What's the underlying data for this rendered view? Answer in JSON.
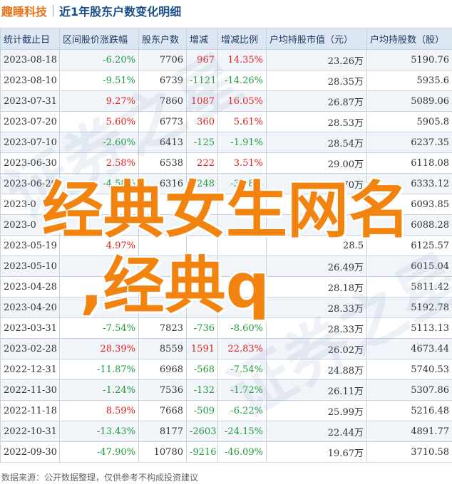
{
  "header": {
    "company": "趣睡科技",
    "title": "近1年股东户数变化明细"
  },
  "table": {
    "columns": [
      "统计截止日",
      "区间股价涨跌幅",
      "股东户数",
      "增减",
      "增减比例",
      "户均持股市值（元）",
      "户均持股数（股）"
    ],
    "rows": [
      {
        "date": "2023-08-18",
        "pct": "-6.20%",
        "holders": "7706",
        "change": "967",
        "ratio": "14.35%",
        "value": "23.26万",
        "shares": "5190.76",
        "pct_dir": "down",
        "change_dir": "up",
        "ratio_dir": "up"
      },
      {
        "date": "2023-08-10",
        "pct": "-9.51%",
        "holders": "6739",
        "change": "-1121",
        "ratio": "-14.26%",
        "value": "28.35万",
        "shares": "5935.6",
        "pct_dir": "down",
        "change_dir": "down",
        "ratio_dir": "down"
      },
      {
        "date": "2023-07-31",
        "pct": "9.27%",
        "holders": "7860",
        "change": "1087",
        "ratio": "16.05%",
        "value": "26.87万",
        "shares": "5089.06",
        "pct_dir": "up",
        "change_dir": "up",
        "ratio_dir": "up"
      },
      {
        "date": "2023-07-20",
        "pct": "5.60%",
        "holders": "6773",
        "change": "360",
        "ratio": "5.61%",
        "value": "28.53万",
        "shares": "5905.8",
        "pct_dir": "up",
        "change_dir": "up",
        "ratio_dir": "up"
      },
      {
        "date": "2023-07-10",
        "pct": "-2.60%",
        "holders": "6413",
        "change": "-125",
        "ratio": "-1.91%",
        "value": "28.54万",
        "shares": "6237.35",
        "pct_dir": "down",
        "change_dir": "down",
        "ratio_dir": "down"
      },
      {
        "date": "2023-06-30",
        "pct": "2.58%",
        "holders": "6538",
        "change": "222",
        "ratio": "3.51%",
        "value": "29.00万",
        "shares": "6118.08",
        "pct_dir": "up",
        "change_dir": "up",
        "ratio_dir": "up"
      },
      {
        "date": "2023-06-20",
        "pct": "-4.58%",
        "holders": "6316",
        "change": "-248",
        "ratio": "-3.78%",
        "value": "29.70万",
        "shares": "6333.12",
        "pct_dir": "down",
        "change_dir": "down",
        "ratio_dir": "down"
      },
      {
        "date": "2023-0",
        "pct": "",
        "holders": "",
        "change": "",
        "ratio": "",
        "value": "",
        "shares": "6093.85",
        "pct_dir": "plain",
        "change_dir": "plain",
        "ratio_dir": "plain"
      },
      {
        "date": "2023-0",
        "pct": "",
        "holders": "",
        "change": "",
        "ratio": "",
        "value": "",
        "shares": "6088.28",
        "pct_dir": "plain",
        "change_dir": "plain",
        "ratio_dir": "plain"
      },
      {
        "date": "2023-05-19",
        "pct": "4.97%",
        "holders": "",
        "change": "",
        "ratio": "",
        "value": "28.5",
        "shares": "6125.57",
        "pct_dir": "up",
        "change_dir": "plain",
        "ratio_dir": "plain"
      },
      {
        "date": "2023-05-10",
        "pct": "",
        "holders": "",
        "change": "",
        "ratio": "",
        "value": "26.49万",
        "shares": "6015.04",
        "pct_dir": "plain",
        "change_dir": "plain",
        "ratio_dir": "plain"
      },
      {
        "date": "2023-04-28",
        "pct": "",
        "holders": "",
        "change": "",
        "ratio": "",
        "value": "28.18万",
        "shares": "5811.42",
        "pct_dir": "plain",
        "change_dir": "plain",
        "ratio_dir": "plain"
      },
      {
        "date": "2023-04-20",
        "pct": "",
        "holders": "",
        "change": "",
        "ratio": "",
        "value": "28.33万",
        "shares": "5192.78",
        "pct_dir": "plain",
        "change_dir": "plain",
        "ratio_dir": "plain"
      },
      {
        "date": "2023-03-31",
        "pct": "-7.54%",
        "holders": "7823",
        "change": "-736",
        "ratio": "-8.60%",
        "value": "28.33万",
        "shares": "5113.13",
        "pct_dir": "down",
        "change_dir": "down",
        "ratio_dir": "down"
      },
      {
        "date": "2023-02-28",
        "pct": "28.39%",
        "holders": "8559",
        "change": "1591",
        "ratio": "22.83%",
        "value": "26.02万",
        "shares": "4673.44",
        "pct_dir": "up",
        "change_dir": "up",
        "ratio_dir": "up"
      },
      {
        "date": "2022-12-31",
        "pct": "-11.87%",
        "holders": "6968",
        "change": "-568",
        "ratio": "-7.54%",
        "value": "24.88万",
        "shares": "5740.53",
        "pct_dir": "down",
        "change_dir": "down",
        "ratio_dir": "down"
      },
      {
        "date": "2022-11-30",
        "pct": "-1.24%",
        "holders": "7536",
        "change": "-132",
        "ratio": "-1.72%",
        "value": "26.11万",
        "shares": "5307.86",
        "pct_dir": "down",
        "change_dir": "down",
        "ratio_dir": "down"
      },
      {
        "date": "2022-11-18",
        "pct": "8.59%",
        "holders": "7668",
        "change": "-509",
        "ratio": "-6.22%",
        "value": "25.99万",
        "shares": "5216.48",
        "pct_dir": "up",
        "change_dir": "down",
        "ratio_dir": "down"
      },
      {
        "date": "2022-10-31",
        "pct": "-13.43%",
        "holders": "8177",
        "change": "-2603",
        "ratio": "-24.15%",
        "value": "22.44万",
        "shares": "4891.77",
        "pct_dir": "down",
        "change_dir": "down",
        "ratio_dir": "down"
      },
      {
        "date": "2022-09-30",
        "pct": "-47.90%",
        "holders": "10780",
        "change": "-9216",
        "ratio": "-46.09%",
        "value": "19.67万",
        "shares": "3710.58",
        "pct_dir": "down",
        "change_dir": "down",
        "ratio_dir": "down"
      }
    ]
  },
  "footer": {
    "source": "数据来源：公开数据整理，仅供参考不构成投资建议"
  },
  "overlay": {
    "line1": "经典女生网名",
    "line2": ",经典q"
  },
  "colors": {
    "up": "#e0201b",
    "down": "#1f9b3a",
    "header_bg": "#dde7f3",
    "overlay": "#f3830f",
    "company": "#e8731a",
    "title": "#1a4f8a"
  }
}
